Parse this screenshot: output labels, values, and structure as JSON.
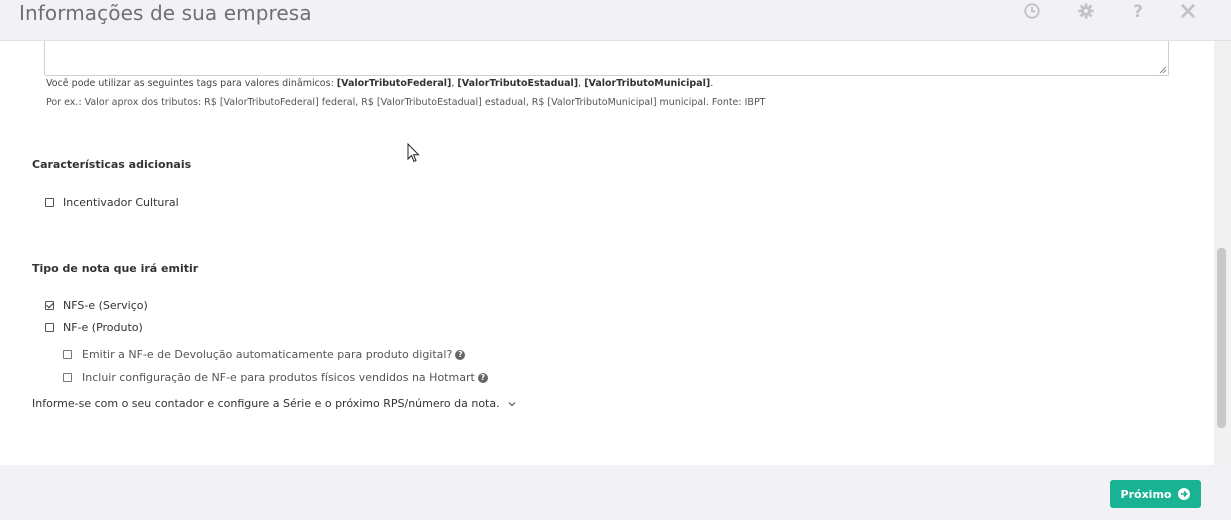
{
  "header": {
    "title": "Informações de sua empresa",
    "icons": [
      "clock-icon",
      "gear-icon",
      "help-icon",
      "close-icon"
    ]
  },
  "tags_help": {
    "prefix": "Você pode utilizar as seguintes tags para valores dinâmicos: ",
    "tag1": "[ValorTributoFederal]",
    "sep1": ", ",
    "tag2": "[ValorTributoEstadual]",
    "sep2": ", ",
    "tag3": "[ValorTributoMunicipal]",
    "suffix": ".",
    "example": "Por ex.: Valor aprox dos tributos: R$ [ValorTributoFederal] federal, R$ [ValorTributoEstadual] estadual, R$ [ValorTributoMunicipal] municipal. Fonte: IBPT"
  },
  "additional": {
    "title": "Características adicionais",
    "options": [
      {
        "label": "Incentivador Cultural",
        "checked": false
      }
    ]
  },
  "invoice_type": {
    "title": "Tipo de nota que irá emitir",
    "options": [
      {
        "label": "NFS-e (Serviço)",
        "checked": true
      },
      {
        "label": "NF-e (Produto)",
        "checked": false
      }
    ],
    "sub_options": [
      {
        "label": "Emitir a NF-e de Devolução automaticamente para produto digital?",
        "checked": false
      },
      {
        "label": "Incluir configuração de NF-e para produtos físicos vendidos na Hotmart",
        "checked": false
      }
    ]
  },
  "info": {
    "text": "Informe-se com o seu contador e configure a Série e o próximo RPS/número da nota."
  },
  "footer": {
    "next_label": "Próximo"
  },
  "colors": {
    "accent": "#19b394",
    "background": "#f2f1f6"
  }
}
